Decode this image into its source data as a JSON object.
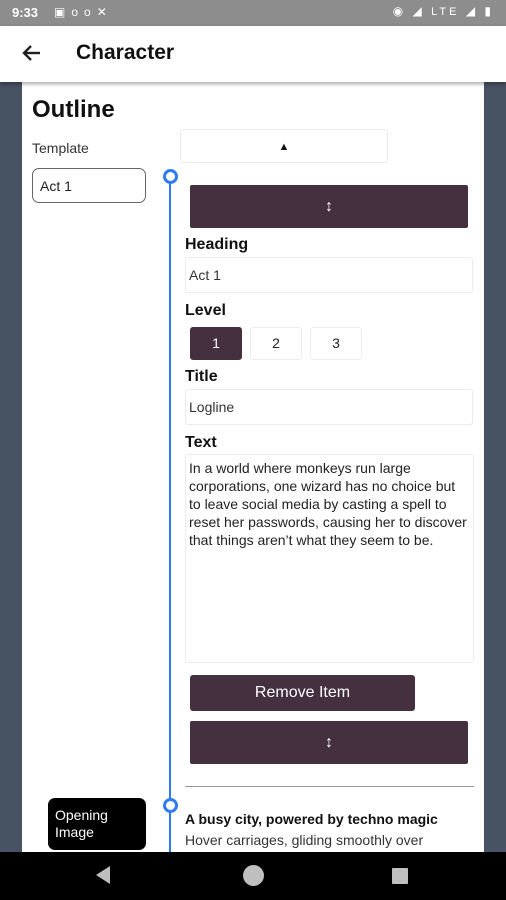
{
  "status_bar": {
    "time": "9:33",
    "icons_left": [
      "image-icon",
      "voicemail-icon",
      "accessibility-icon"
    ],
    "network": "LTE",
    "icons_right": [
      "eye-icon",
      "wifi-icon",
      "signal-icon",
      "battery-icon"
    ]
  },
  "app_bar": {
    "title": "Character",
    "back_icon": "arrow-back-icon"
  },
  "outline": {
    "heading": "Outline",
    "template_label": "Template",
    "template_dropdown_arrow": "▲",
    "section_chip": "Act 1"
  },
  "item": {
    "drag_icon": "↕",
    "heading_label": "Heading",
    "heading_value": "Act 1",
    "level_label": "Level",
    "levels": [
      "1",
      "2",
      "3"
    ],
    "selected_level": "1",
    "title_label": "Title",
    "title_value": "Logline",
    "text_label": "Text",
    "text_value": "In a world where monkeys run large corporations, one wizard has no choice but to leave social media by casting a spell to reset her passwords, causing her to discover that things aren’t what they seem to be.",
    "remove_label": "Remove Item"
  },
  "next_item": {
    "title": "A busy city, powered by techno magic",
    "text": "Hover carriages, gliding smoothly over",
    "tooltip": "Opening Image"
  },
  "colors": {
    "accent": "#44303f",
    "timeline": "#2f7bf0",
    "background": "#475262"
  }
}
